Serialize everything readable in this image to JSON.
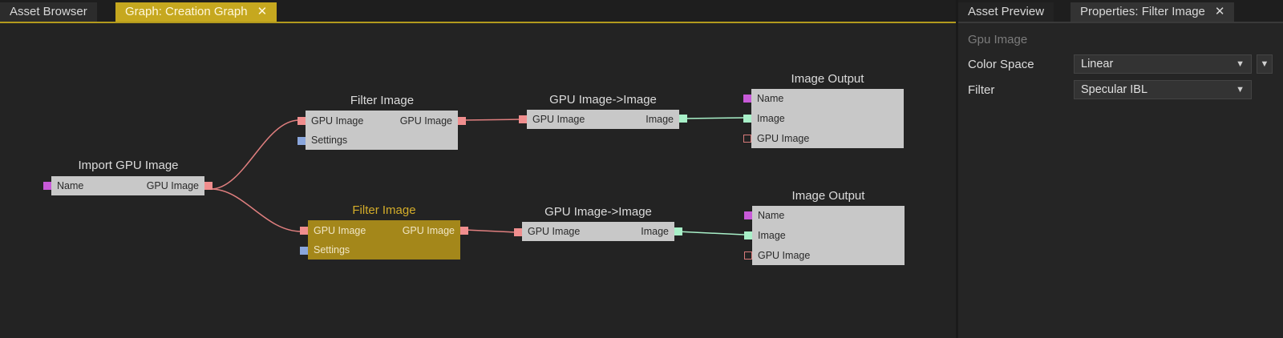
{
  "left_tabs": [
    {
      "label": "Asset Browser",
      "active": false
    },
    {
      "label": "Graph: Creation Graph",
      "active": true,
      "close": "✕"
    }
  ],
  "right_tabs": [
    {
      "label": "Asset Preview",
      "active": false
    },
    {
      "label": "Properties: Filter Image",
      "active": false,
      "close": "✕"
    }
  ],
  "graph": {
    "import_node": {
      "title": "Import GPU Image",
      "in": "Name",
      "out": "GPU Image"
    },
    "filter_top": {
      "title": "Filter Image",
      "in1": "GPU Image",
      "in2": "Settings",
      "out": "GPU Image"
    },
    "filter_bottom": {
      "title": "Filter Image",
      "in1": "GPU Image",
      "in2": "Settings",
      "out": "GPU Image"
    },
    "convert_top": {
      "title": "GPU Image->Image",
      "in": "GPU Image",
      "out": "Image"
    },
    "convert_bottom": {
      "title": "GPU Image->Image",
      "in": "GPU Image",
      "out": "Image"
    },
    "output_top": {
      "title": "Image Output",
      "r1": "Name",
      "r2": "Image",
      "r3": "GPU Image"
    },
    "output_bottom": {
      "title": "Image Output",
      "r1": "Name",
      "r2": "Image",
      "r3": "GPU Image"
    }
  },
  "properties": {
    "section": "Gpu Image",
    "color_space_label": "Color Space",
    "color_space_value": "Linear",
    "filter_label": "Filter",
    "filter_value": "Specular IBL",
    "arrow": "▼"
  }
}
